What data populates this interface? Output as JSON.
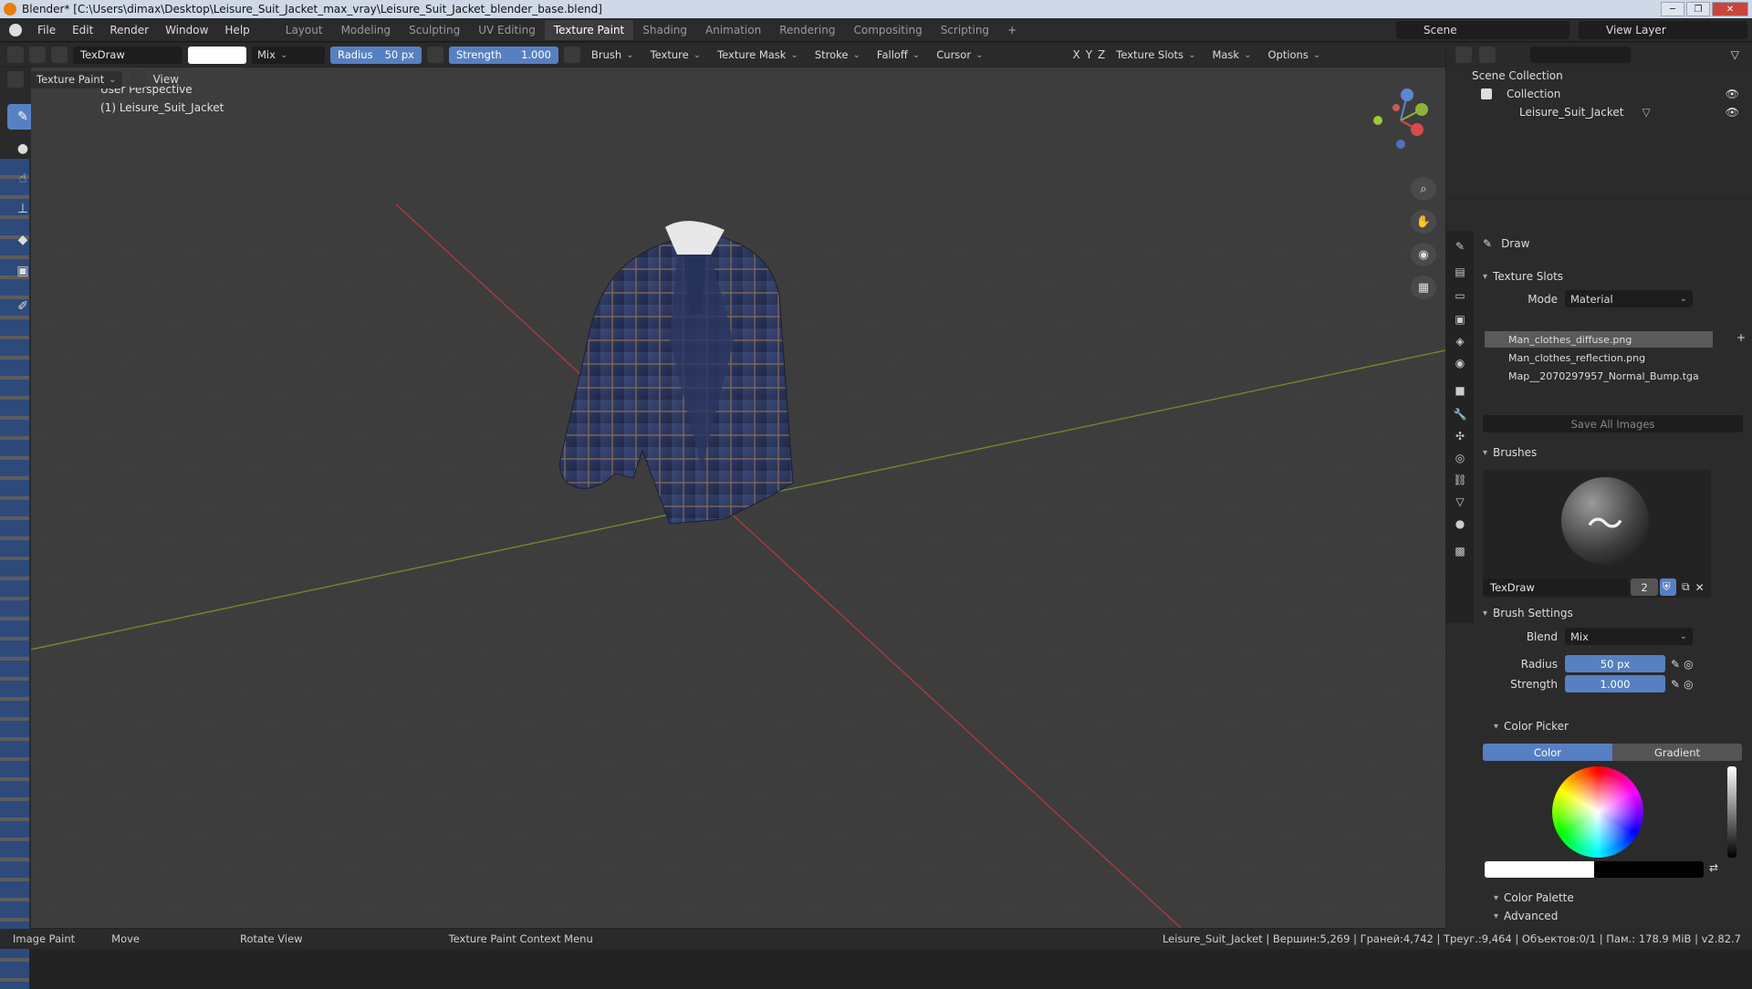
{
  "window": {
    "title": "Blender* [C:\\Users\\dimax\\Desktop\\Leisure_Suit_Jacket_max_vray\\Leisure_Suit_Jacket_blender_base.blend]"
  },
  "menu": [
    "File",
    "Edit",
    "Render",
    "Window",
    "Help"
  ],
  "workspaces": [
    "Layout",
    "Modeling",
    "Sculpting",
    "UV Editing",
    "Texture Paint",
    "Shading",
    "Animation",
    "Rendering",
    "Compositing",
    "Scripting"
  ],
  "active_workspace": "Texture Paint",
  "scene": {
    "label": "Scene",
    "view_layer": "View Layer"
  },
  "tool_header": {
    "brush_name": "TexDraw",
    "blend": "Mix",
    "radius_label": "Radius",
    "radius_value": "50 px",
    "strength_label": "Strength",
    "strength_value": "1.000",
    "menus": [
      "Brush",
      "Texture",
      "Texture Mask",
      "Stroke",
      "Falloff",
      "Cursor"
    ],
    "axes": [
      "X",
      "Y",
      "Z"
    ],
    "texture_slots": "Texture Slots",
    "mask": "Mask",
    "options": "Options"
  },
  "mode_header": {
    "mode": "Texture Paint",
    "view": "View"
  },
  "viewport": {
    "line1": "User Perspective",
    "line2": "(1) Leisure_Suit_Jacket"
  },
  "outliner": {
    "scene_collection": "Scene Collection",
    "collection": "Collection",
    "object": "Leisure_Suit_Jacket"
  },
  "properties": {
    "tool_name": "Draw",
    "texture_slots": {
      "header": "Texture Slots",
      "mode_label": "Mode",
      "mode_value": "Material",
      "slots": [
        "Man_clothes_diffuse.png",
        "Man_clothes_reflection.png",
        "Map__2070297957_Normal_Bump.tga"
      ],
      "save_all": "Save All Images"
    },
    "brushes": {
      "header": "Brushes",
      "name": "TexDraw",
      "users": "2"
    },
    "brush_settings": {
      "header": "Brush Settings",
      "blend_label": "Blend",
      "blend_value": "Mix",
      "radius_label": "Radius",
      "radius_value": "50 px",
      "strength_label": "Strength",
      "strength_value": "1.000",
      "color_picker": "Color Picker",
      "color_tab": "Color",
      "gradient_tab": "Gradient",
      "color_palette": "Color Palette",
      "advanced": "Advanced"
    }
  },
  "status": {
    "left": [
      "Image Paint",
      "Move",
      "Rotate View",
      "Texture Paint Context Menu"
    ],
    "right": "Leisure_Suit_Jacket | Вершин:5,269 | Граней:4,742 | Треуг.:9,464 | Объектов:0/1 | Пам.: 178.9 MiB | v2.82.7"
  },
  "colors": {
    "accent": "#5680c2",
    "viewport_bg": "#3d3d3d",
    "panel_bg": "#2b2b2b"
  }
}
